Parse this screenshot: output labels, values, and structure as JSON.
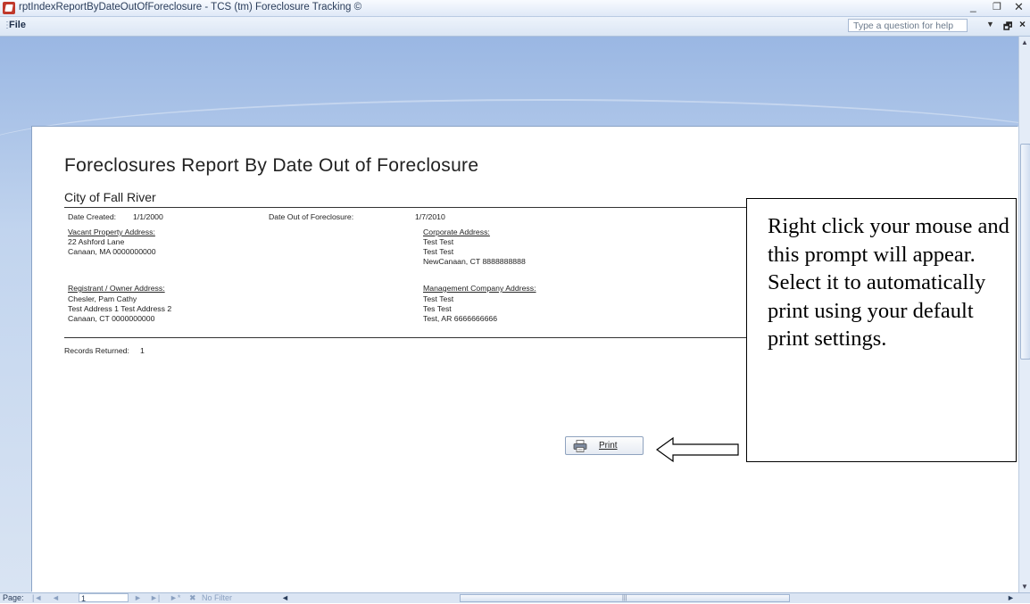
{
  "window": {
    "title": "rptIndexReportByDateOutOfForeclosure - TCS (tm) Foreclosure Tracking ©",
    "min_glyph": "_",
    "max_glyph": "❐",
    "close_glyph": "✕"
  },
  "menu": {
    "file_label": "File",
    "help_placeholder": "Type a question for help",
    "help_drop_glyph": "▼",
    "restore_glyph": "🗗",
    "close_glyph": "×"
  },
  "report": {
    "title": "Foreclosures Report By Date Out of Foreclosure",
    "city": "City of Fall River",
    "date_created_label": "Date Created:",
    "date_created": "1/1/2000",
    "date_out_label": "Date Out of Foreclosure:",
    "date_out": "1/7/2010",
    "vacant_label": "Vacant Property Address:",
    "vacant_lines": [
      "22 Ashford Lane",
      "Canaan, MA 0000000000"
    ],
    "corporate_label": "Corporate Address:",
    "corporate_lines": [
      "Test Test",
      "Test Test",
      "NewCanaan, CT 8888888888"
    ],
    "registrant_label": "Registrant / Owner Address:",
    "registrant_lines": [
      "Chesler, Pam Cathy",
      "Test Address 1 Test Address 2",
      "Canaan, CT 0000000000"
    ],
    "management_label": "Management Company Address:",
    "management_lines": [
      "Test Test",
      "Tes Test",
      "Test, AR 6666666666"
    ],
    "records_label": "Records Returned:",
    "records_count": "1"
  },
  "print_button": {
    "label": "Print"
  },
  "callout": {
    "text": "Right click your mouse and this prompt will appear. Select it to automatically print using your default print settings."
  },
  "statusbar": {
    "page_label": "Page:",
    "nav_first": "|◄",
    "nav_prev": "◄",
    "page_value": "1",
    "nav_next": "►",
    "nav_last": "►|",
    "nav_new": "►*",
    "filter_label": "No Filter",
    "scroll_left": "◄",
    "scroll_grip": "|||",
    "scroll_right": "►"
  },
  "colors": {
    "workspace_top": "#9ab7e3",
    "workspace_bottom": "#d9e4f3",
    "app_icon": "#c0392b"
  }
}
